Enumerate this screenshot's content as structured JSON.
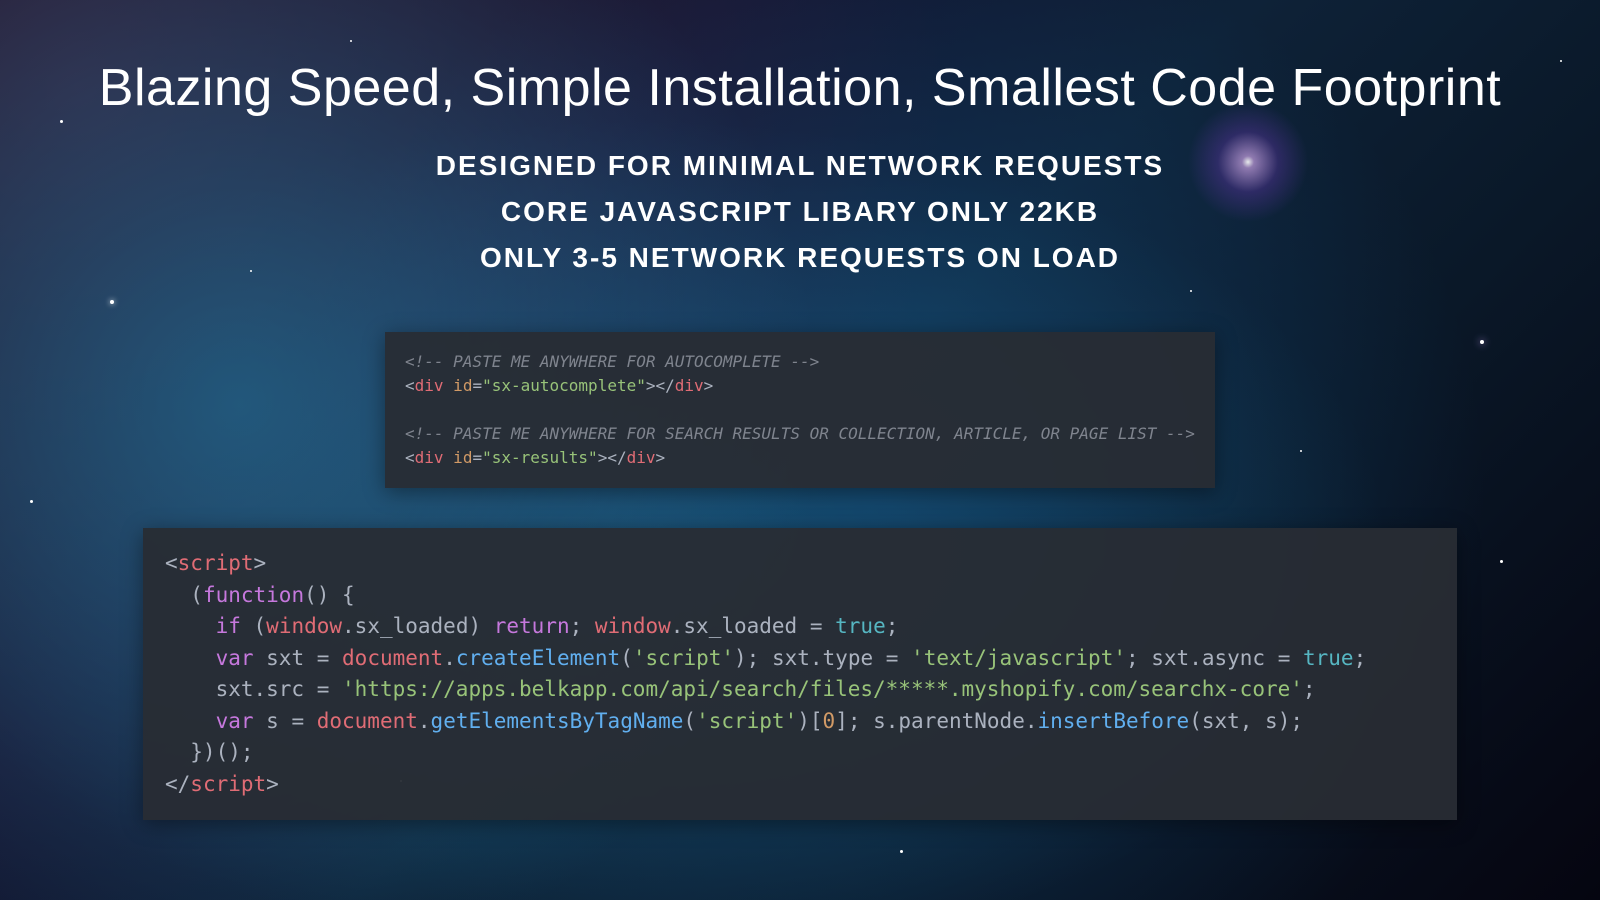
{
  "title": "Blazing Speed, Simple Installation, Smallest Code Footprint",
  "subs": {
    "a": "DESIGNED FOR MINIMAL NETWORK REQUESTS",
    "b": "CORE JAVASCRIPT LIBARY ONLY 22KB",
    "c": "ONLY 3-5 NETWORK REQUESTS ON LOAD"
  },
  "code1": {
    "c1": "<!-- PASTE ME ANYWHERE FOR AUTOCOMPLETE -->",
    "l1a": "<",
    "l1b": "div",
    "l1c": " id",
    "l1d": "=",
    "l1e": "\"sx-autocomplete\"",
    "l1f": "></",
    "l1g": "div",
    "l1h": ">",
    "c2": "<!-- PASTE ME ANYWHERE FOR SEARCH RESULTS OR COLLECTION, ARTICLE, OR PAGE LIST -->",
    "l2a": "<",
    "l2b": "div",
    "l2c": " id",
    "l2d": "=",
    "l2e": "\"sx-results\"",
    "l2f": "></",
    "l2g": "div",
    "l2h": ">"
  },
  "code2": {
    "t0a": "<",
    "t0b": "script",
    "t0c": ">",
    "t1a": "  (",
    "t1b": "function",
    "t1c": "() {",
    "t2a": "    ",
    "t2b": "if",
    "t2c": " (",
    "t2d": "window",
    "t2e": ".sx_loaded) ",
    "t2f": "return",
    "t2g": "; ",
    "t2h": "window",
    "t2i": ".sx_loaded = ",
    "t2j": "true",
    "t2k": ";",
    "t3a": "    ",
    "t3b": "var",
    "t3c": " sxt = ",
    "t3d": "document",
    "t3e": ".",
    "t3f": "createElement",
    "t3g": "(",
    "t3h": "'script'",
    "t3i": "); sxt.type = ",
    "t3j": "'text/javascript'",
    "t3k": "; sxt.async = ",
    "t3l": "true",
    "t3m": ";",
    "t4a": "    sxt.src = ",
    "t4b": "'https://apps.belkapp.com/api/search/files/*****.myshopify.com/searchx-core'",
    "t4c": ";",
    "t5a": "    ",
    "t5b": "var",
    "t5c": " s = ",
    "t5d": "document",
    "t5e": ".",
    "t5f": "getElementsByTagName",
    "t5g": "(",
    "t5h": "'script'",
    "t5i": ")[",
    "t5j": "0",
    "t5k": "]; s.parentNode.",
    "t5l": "insertBefore",
    "t5m": "(sxt, s);",
    "t6": "  })();",
    "t7a": "</",
    "t7b": "script",
    "t7c": ">"
  }
}
